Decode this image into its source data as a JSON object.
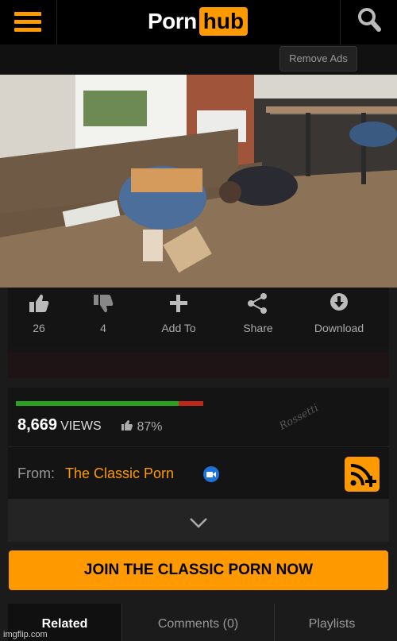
{
  "header": {
    "logo_left": "Porn",
    "logo_right": "hub"
  },
  "ads": {
    "remove_label": "Remove Ads"
  },
  "actions": {
    "like_count": "26",
    "dislike_count": "4",
    "add_label": "Add To",
    "share_label": "Share",
    "download_label": "Download"
  },
  "stats": {
    "views_count": "8,669",
    "views_label": "VIEWS",
    "rating": "87%",
    "rating_fraction": 0.87,
    "watermark": "Rossetti"
  },
  "channel": {
    "from_label": "From:",
    "name": "The Classic Porn"
  },
  "join_label": "JOIN THE CLASSIC PORN NOW",
  "tabs": [
    {
      "label": "Related"
    },
    {
      "label": "Comments (0)"
    },
    {
      "label": "Playlists"
    }
  ],
  "footer": {
    "imgflip": "imgflip.com"
  },
  "colors": {
    "accent": "#ff9900",
    "like_green": "#27a31f",
    "dislike_red": "#c0271b",
    "verified_blue": "#1e73d9"
  },
  "icons": [
    "menu-icon",
    "search-icon",
    "thumbs-up-icon",
    "thumbs-down-icon",
    "plus-icon",
    "share-icon",
    "download-icon",
    "verified-icon",
    "subscribe-rss-icon",
    "chevron-down-icon"
  ]
}
